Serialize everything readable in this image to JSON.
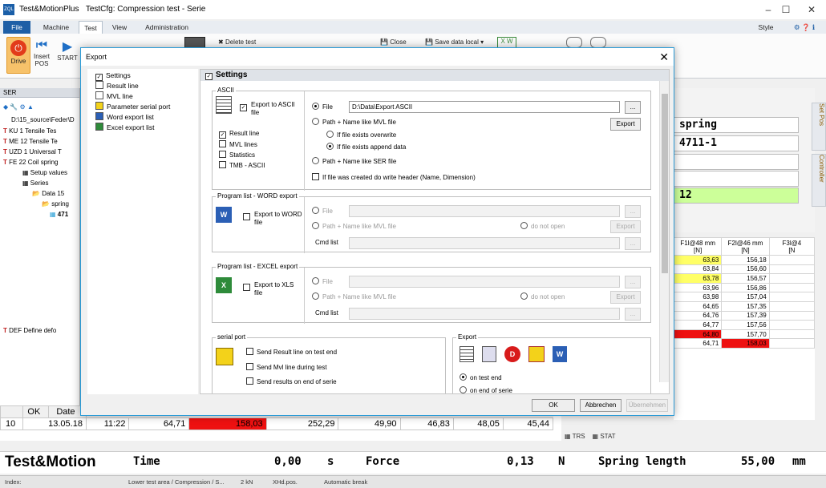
{
  "window": {
    "app_name": "Test&MotionPlus",
    "doc_title": "TestCfg: Compression test - Serie",
    "logo_text": "ZQL"
  },
  "menu": {
    "tabs": [
      "File",
      "Machine",
      "Test",
      "View",
      "Administration"
    ],
    "active": "Test",
    "style_label": "Style"
  },
  "ribbon": {
    "drive": "Drive",
    "insert_pos": "Insert\nPOS",
    "start": "START",
    "delete_test": "Delete test",
    "close": "Close",
    "save_data_local": "Save data local"
  },
  "tree_panel": {
    "title": "SER",
    "path": "D:\\15_source\\Feder\\D",
    "items": [
      {
        "text": "KU 1   Tensile Tes"
      },
      {
        "text": "ME 12  Tensile Te"
      },
      {
        "text": "UZD 1  Universal T"
      },
      {
        "text": "FE 22  Coil spring"
      },
      {
        "text": "Setup values"
      },
      {
        "text": "Series"
      },
      {
        "text": "Data 15"
      },
      {
        "text": "spring"
      },
      {
        "text": "471"
      },
      {
        "text": "DEF   Define defo"
      }
    ]
  },
  "right_panel": {
    "fields": [
      "spring",
      "4711-1",
      "",
      "",
      "12"
    ],
    "tabs": [
      "Set Pos",
      "Controller"
    ]
  },
  "grid": {
    "headers": [
      "F1l@48 mm\n[N]",
      "F2l@46 mm\n[N]",
      "F3l@4\n[N"
    ],
    "rows": [
      [
        "63,63",
        "156,18"
      ],
      [
        "63,84",
        "156,60"
      ],
      [
        "63,78",
        "156,57"
      ],
      [
        "63,96",
        "156,86"
      ],
      [
        "63,98",
        "157,04"
      ],
      [
        "64,65",
        "157,35"
      ],
      [
        "64,76",
        "157,39"
      ],
      [
        "64,77",
        "157,56"
      ],
      [
        "64,80",
        "157,70"
      ],
      [
        "64,71",
        "158,03"
      ]
    ],
    "highlights": {
      "yellow_rows": [
        0,
        2
      ],
      "red_row_first": 8,
      "red_row_last_second": 9
    },
    "bottom_tabs": [
      "TRS",
      "STAT"
    ]
  },
  "bottom_table": {
    "headers": [
      "OK",
      "Date"
    ],
    "row": [
      "10",
      "13.05.18",
      "11:22",
      "64,71",
      "158,03",
      "252,29",
      "49,90",
      "46,83",
      "48,05",
      "45,44"
    ]
  },
  "status_big": {
    "brand": "Test&Motion",
    "time_label": "Time",
    "time_value": "0,00",
    "time_unit": "s",
    "force_label": "Force",
    "force_value": "0,13",
    "force_unit": "N",
    "spring_label": "Spring length",
    "spring_value": "55,00",
    "spring_unit": "mm"
  },
  "statusbar": {
    "items": [
      "Index:",
      "Lower test area / Compression / S...",
      "2 kN",
      "XHd.pos.",
      "Automatic break"
    ]
  },
  "dialog": {
    "title": "Export",
    "nav": [
      "Settings",
      "Result line",
      "MVL line",
      "Parameter serial port",
      "Word export list",
      "Excel export list"
    ],
    "section_title": "Settings",
    "ascii": {
      "group": "ASCII",
      "export_to_ascii": "Export to ASCII\nfile",
      "result_line": "Result line",
      "mvl_lines": "MVL lines",
      "statistics": "Statistics",
      "tmb_ascii": "TMB - ASCII",
      "file": "File",
      "file_value": "D:\\Data\\Export ASCII",
      "path_mvl": "Path + Name like MVL file",
      "overwrite": "If file exists overwrite",
      "append": "If file exists append data",
      "path_ser": "Path + Name like SER file",
      "header": "If file was created do write header (Name, Dimension)",
      "export_btn": "Export",
      "browse": "..."
    },
    "word": {
      "group": "Program list - WORD export",
      "export_to": "Export to WORD\nfile",
      "file": "File",
      "path_mvl": "Path + Name like MVL file",
      "do_not_open": "do not open",
      "export_btn": "Export",
      "cmd_list": "Cmd list",
      "browse": "..."
    },
    "excel": {
      "group": "Program list - EXCEL export",
      "export_to": "Export to XLS\nfile",
      "file": "File",
      "path_mvl": "Path + Name like MVL file",
      "do_not_open": "do not open",
      "export_btn": "Export",
      "cmd_list": "Cmd list",
      "browse": "..."
    },
    "serial": {
      "group": "serial port",
      "items": [
        "Send Result line on test end",
        "Send Mvl line during test",
        "Send results on end of serie"
      ]
    },
    "export_group": {
      "group": "Export",
      "on_test_end": "on test end",
      "on_end_of_serie": "on end of serie"
    },
    "buttons": {
      "ok": "OK",
      "cancel": "Abbrechen",
      "apply": "Übernehmen"
    }
  },
  "colors": {
    "accent": "#2b9bd6",
    "yellow": "#ffff66",
    "red": "#ee1111",
    "green": "#ccff99"
  }
}
